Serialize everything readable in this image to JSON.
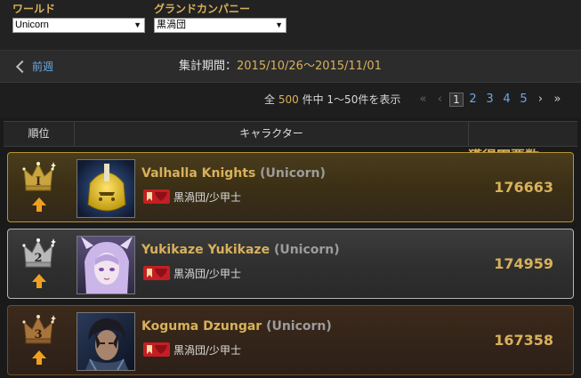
{
  "filters": {
    "world": {
      "label": "ワールド",
      "value": "Unicorn"
    },
    "grand_company": {
      "label": "グランドカンパニー",
      "value": "黒渦団"
    }
  },
  "period_bar": {
    "prev_label": "前週",
    "period_label": "集計期間：",
    "period_value": "2015/10/26〜2015/11/01"
  },
  "pagination": {
    "summary_prefix": "全",
    "total": "500",
    "summary_mid": "件中",
    "summary_range": "1〜50件を表示",
    "first": "«",
    "prev": "‹",
    "pages": [
      "1",
      "2",
      "3",
      "4",
      "5"
    ],
    "current_page": "1",
    "next": "›",
    "last": "»"
  },
  "table": {
    "headers": {
      "rank": "順位",
      "character": "キャラクター",
      "votes": "獲得軍票数"
    },
    "rows": [
      {
        "rank_numeral": "I",
        "name": "Valhalla Knights",
        "server": "(Unicorn)",
        "gc_rank": "黒渦団/少甲士",
        "votes": "176663",
        "tier": "gold",
        "trend": "up"
      },
      {
        "rank_numeral": "2",
        "name": "Yukikaze Yukikaze",
        "server": "(Unicorn)",
        "gc_rank": "黒渦団/少甲士",
        "votes": "174959",
        "tier": "silver",
        "trend": "up"
      },
      {
        "rank_numeral": "3",
        "name": "Koguma Dzungar",
        "server": "(Unicorn)",
        "gc_rank": "黒渦団/少甲士",
        "votes": "167358",
        "tier": "bronze",
        "trend": "up"
      }
    ]
  },
  "icons": {
    "prev": "chevron-left-icon",
    "select_arrow": "triangle-down-icon",
    "trend_up": "arrow-up-icon",
    "gc_emblem": "maelstrom-emblem-icon"
  },
  "colors": {
    "accent_gold": "#d8b15a",
    "link_blue": "#6aa9e8",
    "trend_orange": "#f0a020",
    "gc_red": "#c41e24"
  }
}
